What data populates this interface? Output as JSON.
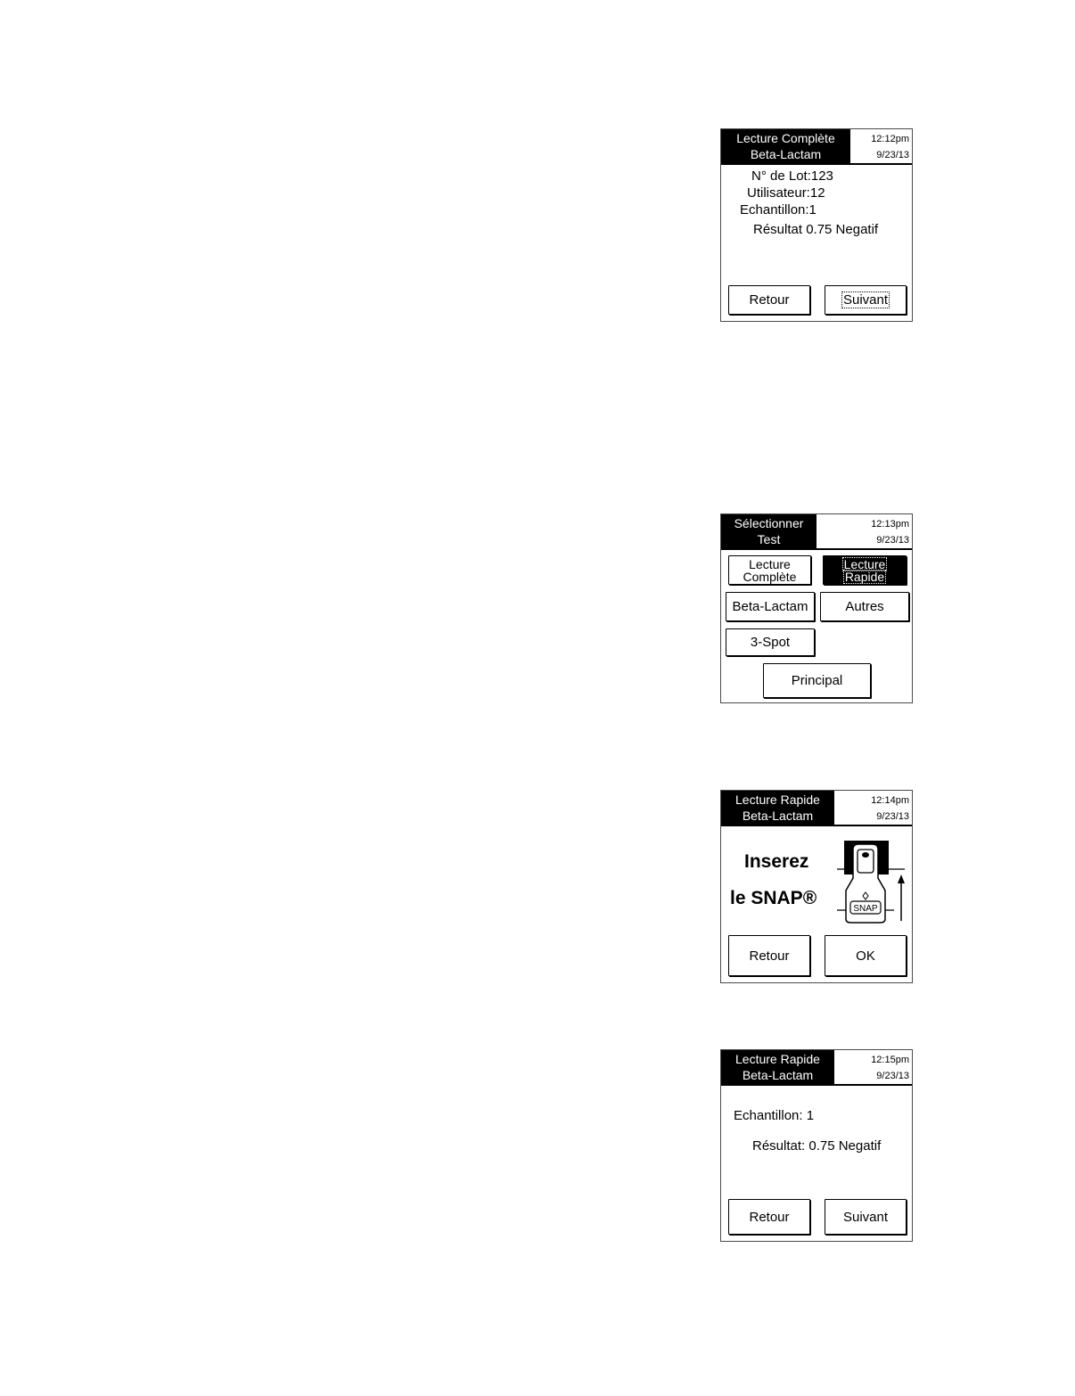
{
  "screen1": {
    "title_line1": "Lecture Complète",
    "title_line2": "Beta-Lactam",
    "time": "12:12pm",
    "date": "9/23/13",
    "lot": "N° de Lot:123",
    "user": "Utilisateur:12",
    "sample": "Echantillon:1",
    "result": "Résultat 0.75 Negatif",
    "back_label": "Retour",
    "next_label": "Suivant"
  },
  "screen2": {
    "title_line1": "Sélectionner",
    "title_line2": "Test",
    "time": "12:13pm",
    "date": "9/23/13",
    "full_read_line1": "Lecture",
    "full_read_line2": "Complète",
    "quick_read_line1": "Lecture",
    "quick_read_line2": "Rapide",
    "beta_lactam_label": "Beta-Lactam",
    "others_label": "Autres",
    "three_spot_label": "3-Spot",
    "main_label": "Principal"
  },
  "screen3": {
    "title_line1": "Lecture Rapide",
    "title_line2": "Beta-Lactam",
    "time": "12:14pm",
    "date": "9/23/13",
    "insert_line1": "Inserez",
    "insert_line2": "le SNAP®",
    "snap_logo": "SNAP",
    "back_label": "Retour",
    "ok_label": "OK"
  },
  "screen4": {
    "title_line1": "Lecture Rapide",
    "title_line2": "Beta-Lactam",
    "time": "12:15pm",
    "date": "9/23/13",
    "sample": "Echantillon: 1",
    "result": "Résultat: 0.75 Negatif",
    "back_label": "Retour",
    "next_label": "Suivant"
  }
}
